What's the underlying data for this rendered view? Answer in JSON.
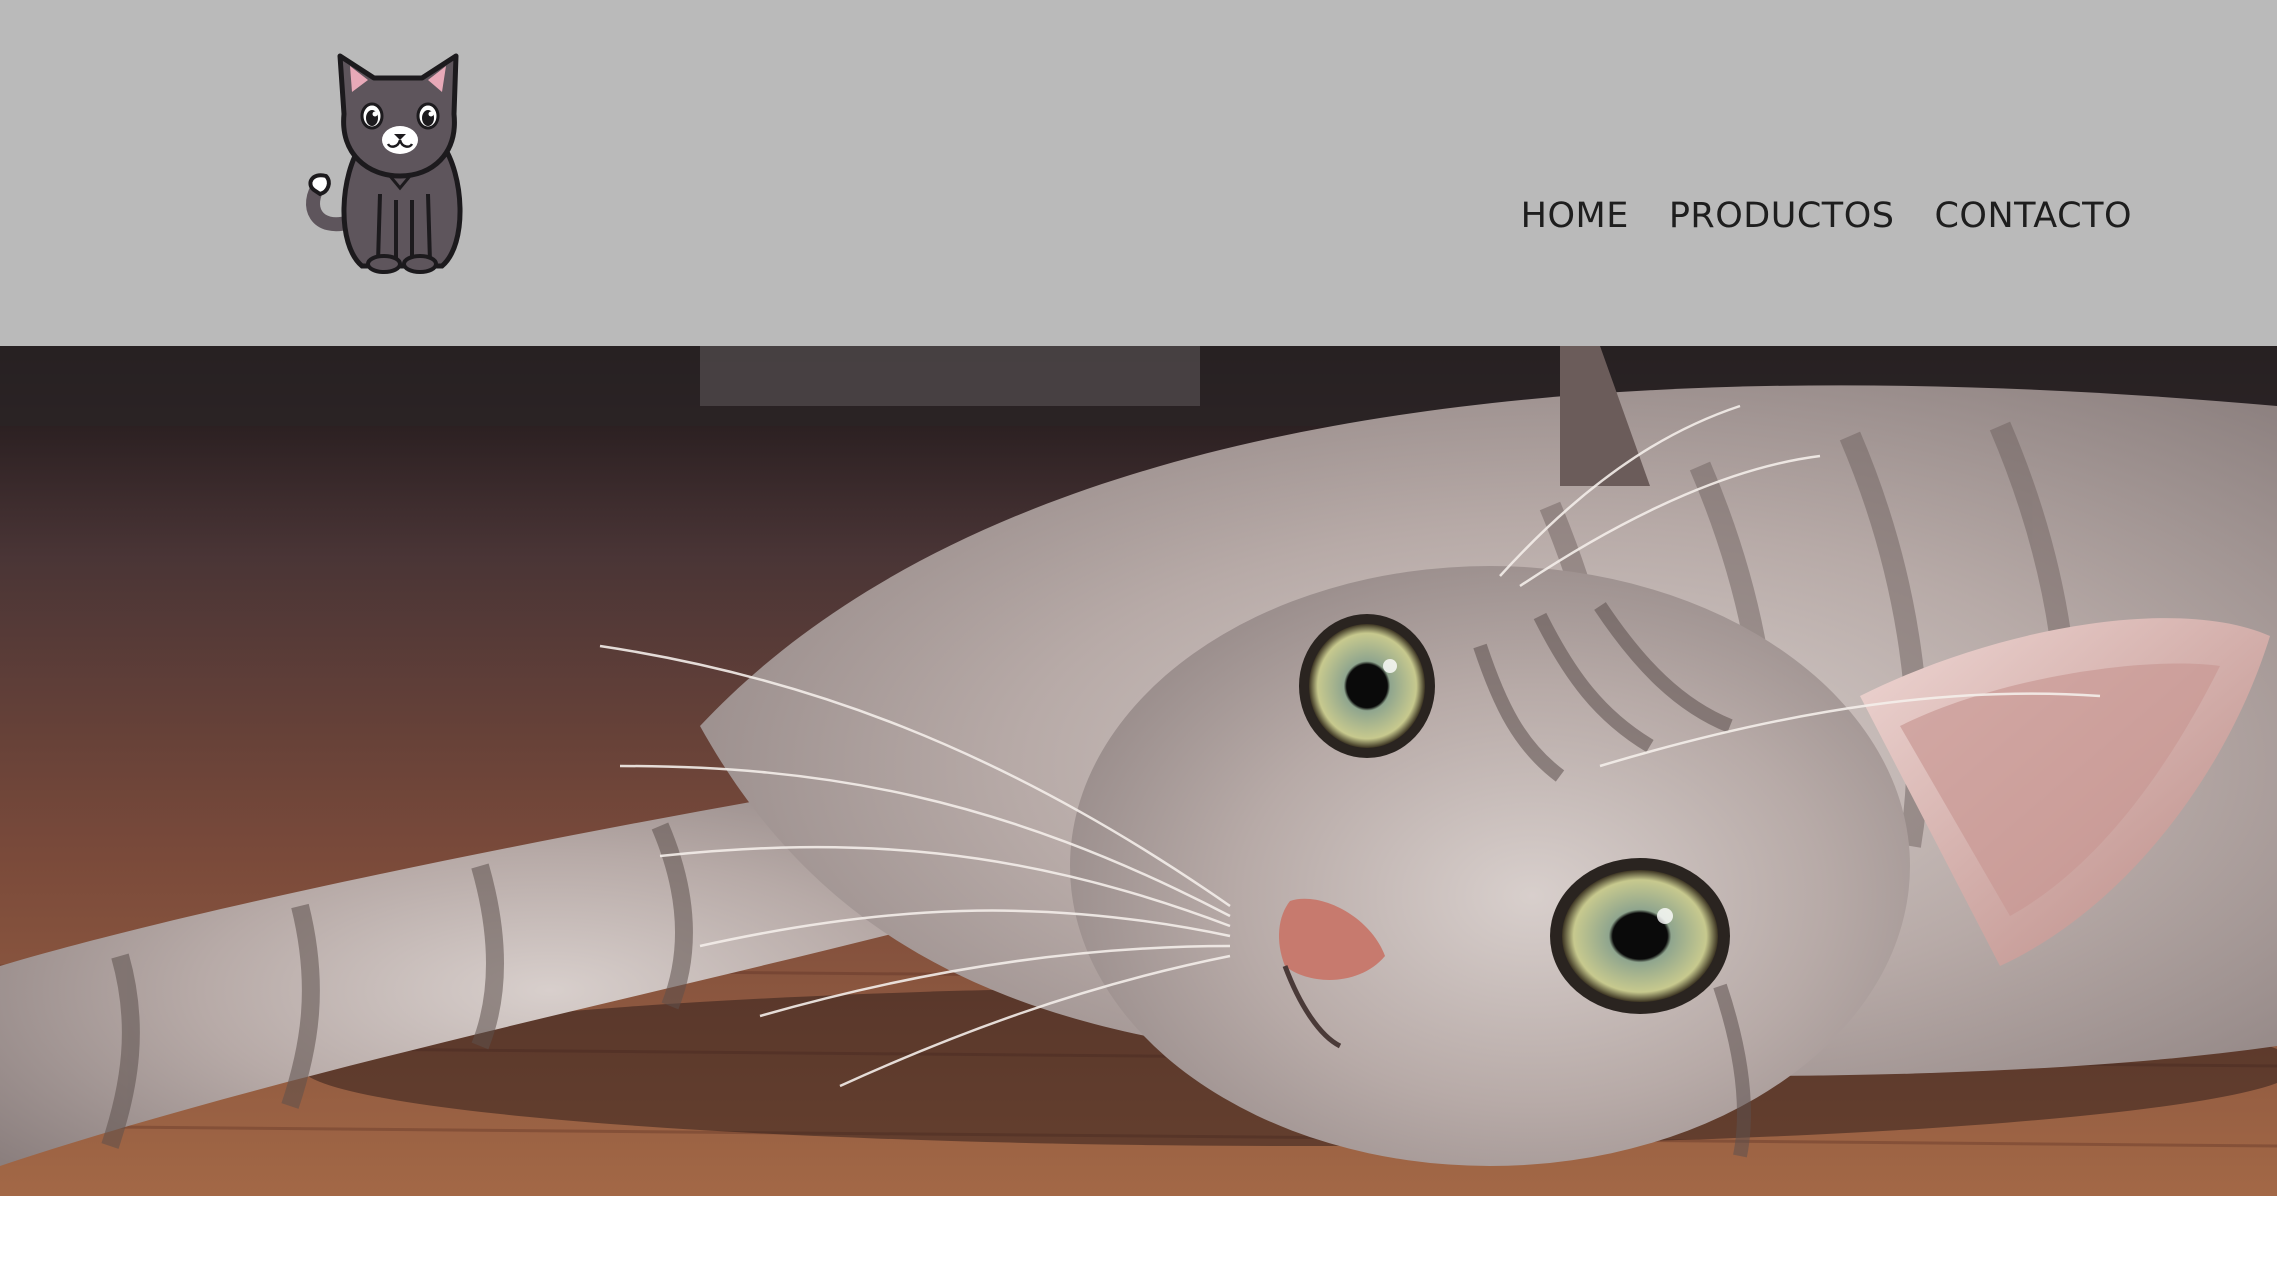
{
  "header": {
    "background": "#bababa",
    "logo_icon": "cat-logo-icon"
  },
  "nav": {
    "items": [
      {
        "label": "HOME"
      },
      {
        "label": "PRODUCTOS"
      },
      {
        "label": "CONTACTO"
      }
    ]
  },
  "hero": {
    "image_icon": "cat-photo"
  }
}
